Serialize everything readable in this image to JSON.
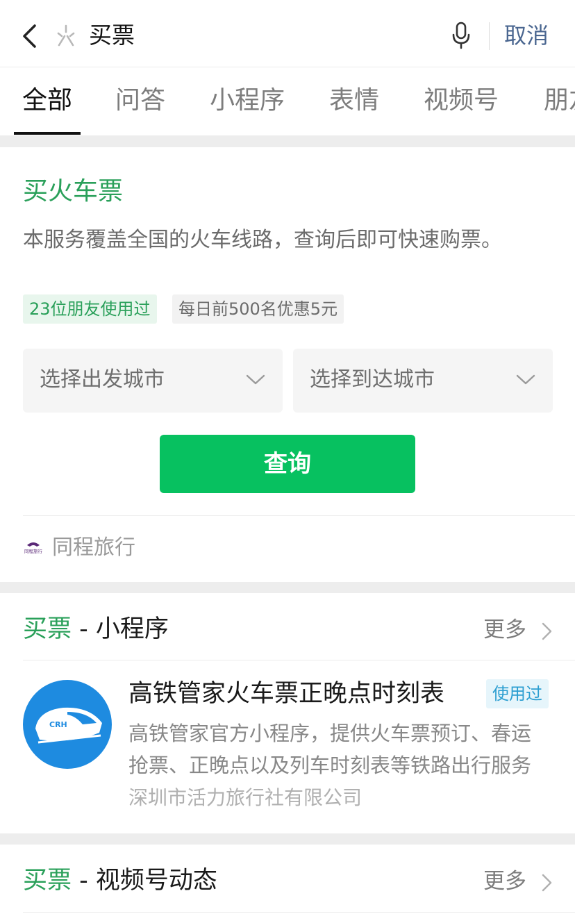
{
  "search": {
    "query": "买票",
    "cancel_label": "取消"
  },
  "tabs": [
    {
      "label": "全部",
      "active": true
    },
    {
      "label": "问答"
    },
    {
      "label": "小程序"
    },
    {
      "label": "表情"
    },
    {
      "label": "视频号"
    },
    {
      "label": "朋友"
    }
  ],
  "train_card": {
    "title": "买火车票",
    "description": "本服务覆盖全国的火车线路，查询后即可快速购票。",
    "tags": [
      "23位朋友使用过",
      "每日前500名优惠5元"
    ],
    "departure_placeholder": "选择出发城市",
    "arrival_placeholder": "选择到达城市",
    "query_label": "查询",
    "provider": "同程旅行",
    "provider_logo_text": "同程旅行"
  },
  "mini_program_section": {
    "keyword": "买票",
    "suffix": " - 小程序",
    "more_label": "更多",
    "items": [
      {
        "title": "高铁管家火车票正晚点时刻表",
        "badge": "使用过",
        "description": "高铁管家官方小程序，提供火车票预订、春运抢票、正晚点以及列车时刻表等铁路出行服务",
        "organization": "深圳市活力旅行社有限公司",
        "icon_text": "CRH"
      }
    ]
  },
  "video_section": {
    "keyword": "买票",
    "suffix": " - 视频号动态",
    "more_label": "更多"
  },
  "colors": {
    "accent_green": "#07c160",
    "keyword_green": "#2aa05a",
    "link_blue": "#4a6690",
    "icon_blue": "#1e8be0"
  }
}
